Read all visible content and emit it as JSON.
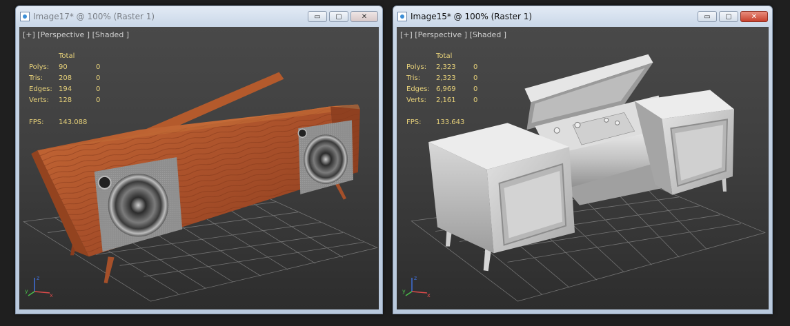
{
  "windows": [
    {
      "title": "Image17* @ 100% (Raster 1)",
      "viewport_label": "[+] [Perspective ] [Shaded ]",
      "stats_header": "Total",
      "stats": [
        {
          "label": "Polys:",
          "total": "90",
          "selected": "0"
        },
        {
          "label": "Tris:",
          "total": "208",
          "selected": "0"
        },
        {
          "label": "Edges:",
          "total": "194",
          "selected": "0"
        },
        {
          "label": "Verts:",
          "total": "128",
          "selected": "0"
        }
      ],
      "fps_label": "FPS:",
      "fps_value": "143.088",
      "active": false
    },
    {
      "title": "Image15* @ 100% (Raster 1)",
      "viewport_label": "[+] [Perspective ] [Shaded ]",
      "stats_header": "Total",
      "stats": [
        {
          "label": "Polys:",
          "total": "2,323",
          "selected": "0"
        },
        {
          "label": "Tris:",
          "total": "2,323",
          "selected": "0"
        },
        {
          "label": "Edges:",
          "total": "6,969",
          "selected": "0"
        },
        {
          "label": "Verts:",
          "total": "2,161",
          "selected": "0"
        }
      ],
      "fps_label": "FPS:",
      "fps_value": "133.643",
      "active": true
    }
  ],
  "controls": {
    "minimize": "▭",
    "maximize": "▢",
    "close": "✕"
  },
  "icons": [
    "app-icon",
    "minimize-icon",
    "maximize-icon",
    "close-icon",
    "axis-gizmo-icon"
  ],
  "colors": {
    "stats_text": "#e8d27a",
    "viewport_bg": "#3f3f3f",
    "wood": "#b4572a",
    "gray_model": "#c8c8c8"
  }
}
